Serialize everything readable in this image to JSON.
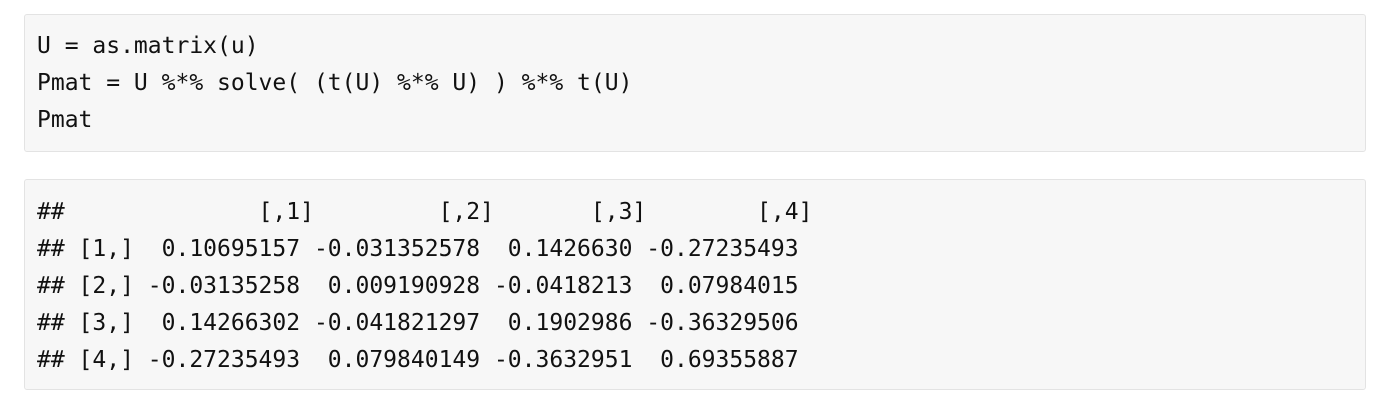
{
  "code_chunk": {
    "lines": [
      "U = as.matrix(u)",
      "Pmat = U %*% solve( (t(U) %*% U) ) %*% t(U)",
      "Pmat"
    ]
  },
  "output_chunk": {
    "lines": [
      "##              [,1]         [,2]       [,3]        [,4]",
      "## [1,]  0.10695157 -0.031352578  0.1426630 -0.27235493",
      "## [2,] -0.03135258  0.009190928 -0.0418213  0.07984015",
      "## [3,]  0.14266302 -0.041821297  0.1902986 -0.36329506",
      "## [4,] -0.27235493  0.079840149 -0.3632951  0.69355887"
    ]
  }
}
